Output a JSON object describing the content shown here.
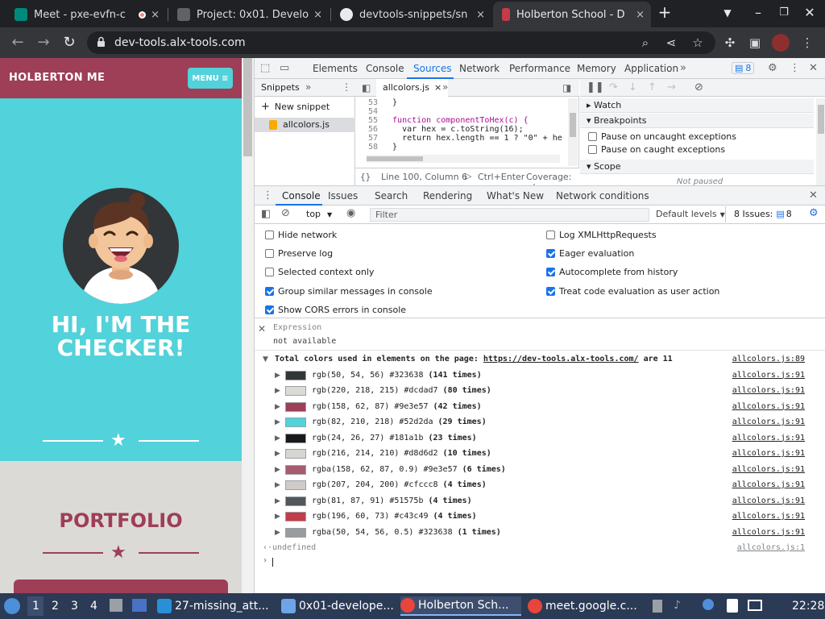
{
  "browser": {
    "tabs": [
      {
        "label": "Meet - pxe-evfn-c",
        "close": "×"
      },
      {
        "label": "Project: 0x01. Develo",
        "close": "×"
      },
      {
        "label": "devtools-snippets/sn",
        "close": "×"
      },
      {
        "label": "Holberton School - D",
        "close": "×"
      }
    ],
    "new_tab": "+",
    "url": "dev-tools.alx-tools.com"
  },
  "webpage": {
    "brand": "HOLBERTON ME",
    "menu_label": "MENU ≡",
    "hero_title": "HI, I'M THE CHECKER!",
    "portfolio_title": "PORTFOLIO"
  },
  "devtools": {
    "main_tabs": [
      "Elements",
      "Console",
      "Sources",
      "Network",
      "Performance",
      "Memory",
      "Application"
    ],
    "selected_tab": "Sources",
    "issues_badge": "8",
    "snippets_label": "Snippets",
    "new_snippet": "New snippet",
    "snippet_file": "allcolors.js",
    "editor_tab": "allcolors.js",
    "code_lines": [
      {
        "n": "53",
        "text": "  }"
      },
      {
        "n": "54",
        "text": ""
      },
      {
        "n": "55",
        "text": "  function componentToHex(c) {"
      },
      {
        "n": "56",
        "text": "    var hex = c.toString(16);"
      },
      {
        "n": "57",
        "text": "    return hex.length == 1 ? \"0\" + he"
      },
      {
        "n": "58",
        "text": "  }"
      }
    ],
    "status_position": "Line 100, Column 6",
    "status_run": "Ctrl+Enter",
    "status_coverage": "Coverage: n/",
    "watch": "Watch",
    "breakpoints": "Breakpoints",
    "pause_uncaught": "Pause on uncaught exceptions",
    "pause_caught": "Pause on caught exceptions",
    "scope": "Scope",
    "not_paused": "Not paused",
    "drawer_tabs": [
      "Console",
      "Issues",
      "Search",
      "Rendering",
      "What's New",
      "Network conditions"
    ],
    "context": "top",
    "filter_placeholder": "Filter",
    "levels": "Default levels",
    "issues_count": "8 Issues:",
    "issues_num": "8",
    "settings_left": [
      {
        "label": "Hide network",
        "checked": false
      },
      {
        "label": "Preserve log",
        "checked": false
      },
      {
        "label": "Selected context only",
        "checked": false
      },
      {
        "label": "Group similar messages in console",
        "checked": true
      },
      {
        "label": "Show CORS errors in console",
        "checked": true
      }
    ],
    "settings_right": [
      {
        "label": "Log XMLHttpRequests",
        "checked": false
      },
      {
        "label": "Eager evaluation",
        "checked": true
      },
      {
        "label": "Autocomplete from history",
        "checked": true
      },
      {
        "label": "Treat code evaluation as user action",
        "checked": true
      }
    ],
    "expression_label": "Expression",
    "expression_value": "not available",
    "group_text_pre": "Total colors used in elements on the page: ",
    "group_link": "https://dev-tools.alx-tools.com/",
    "group_text_post": " are 11",
    "group_src": "allcolors.js:89",
    "colors": [
      {
        "swatch": "#323638",
        "text": "rgb(50, 54, 56) #323638",
        "count": "(141 times)",
        "src": "allcolors.js:91"
      },
      {
        "swatch": "#dcdad7",
        "text": "rgb(220, 218, 215) #dcdad7",
        "count": "(80 times)",
        "src": "allcolors.js:91"
      },
      {
        "swatch": "#9e3e57",
        "text": "rgb(158, 62, 87) #9e3e57",
        "count": "(42 times)",
        "src": "allcolors.js:91"
      },
      {
        "swatch": "#52d2da",
        "text": "rgb(82, 210, 218) #52d2da",
        "count": "(29 times)",
        "src": "allcolors.js:91"
      },
      {
        "swatch": "#181a1b",
        "text": "rgb(24, 26, 27) #181a1b",
        "count": "(23 times)",
        "src": "allcolors.js:91"
      },
      {
        "swatch": "#d8d6d2",
        "text": "rgb(216, 214, 210) #d8d6d2",
        "count": "(10 times)",
        "src": "allcolors.js:91"
      },
      {
        "swatch": "#a85a6e",
        "text": "rgba(158, 62, 87, 0.9) #9e3e57",
        "count": "(6 times)",
        "src": "allcolors.js:91"
      },
      {
        "swatch": "#cfccc8",
        "text": "rgb(207, 204, 200) #cfccc8",
        "count": "(4 times)",
        "src": "allcolors.js:91"
      },
      {
        "swatch": "#51575b",
        "text": "rgb(81, 87, 91) #51575b",
        "count": "(4 times)",
        "src": "allcolors.js:91"
      },
      {
        "swatch": "#c43c49",
        "text": "rgb(196, 60, 73) #c43c49",
        "count": "(4 times)",
        "src": "allcolors.js:91"
      },
      {
        "swatch": "#999b9c",
        "text": "rgba(50, 54, 56, 0.5) #323638",
        "count": "(1 times)",
        "src": "allcolors.js:91"
      }
    ],
    "result": "undefined",
    "result_src": "allcolors.js:1"
  },
  "taskbar": {
    "workspaces": [
      "1",
      "2",
      "3",
      "4"
    ],
    "apps": [
      {
        "label": "27-missing_att..."
      },
      {
        "label": "0x01-develope..."
      },
      {
        "label": "Holberton Sch..."
      },
      {
        "label": "meet.google.c..."
      }
    ],
    "clock": "22:28"
  }
}
